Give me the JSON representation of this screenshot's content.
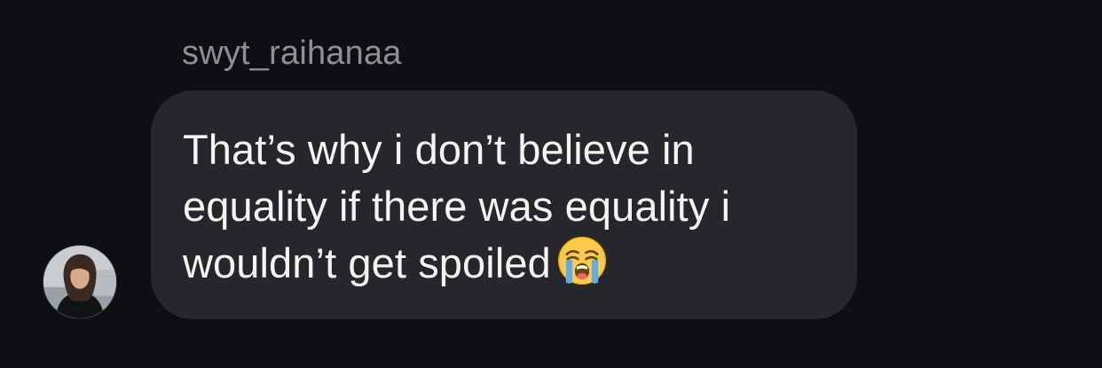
{
  "message": {
    "sender": "swyt_raihanaa",
    "text": "That’s why i don’t believe in\nequality if there was equality i\nwouldn’t get spoiled",
    "emoji": "loudly-crying-face-icon"
  },
  "colors": {
    "background": "#0e0f13",
    "bubble": "#25272b",
    "sender_text": "#8e8f96",
    "message_text": "#f4f4f5"
  }
}
